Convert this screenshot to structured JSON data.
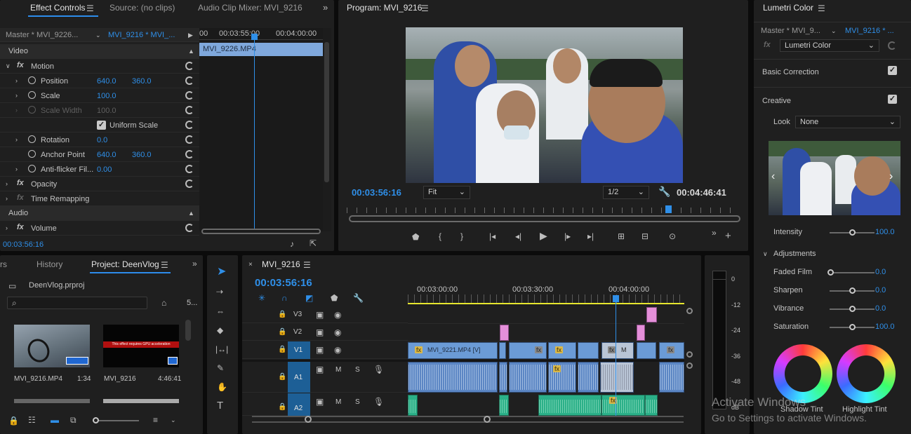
{
  "effect_controls": {
    "tabs": [
      "Effect Controls",
      "Source: (no clips)",
      "Audio Clip Mixer: MVI_9216"
    ],
    "master_label": "Master * MVI_9226...",
    "sequence_label": "MVI_9216 * MVI_...",
    "ruler_times": [
      "00:03:55:00",
      "00:04:00:00"
    ],
    "ruler_left": "00",
    "clip_name": "MVI_9226.MP4",
    "video_header": "Video",
    "motion": "Motion",
    "position_label": "Position",
    "position_x": "640.0",
    "position_y": "360.0",
    "scale_label": "Scale",
    "scale_value": "100.0",
    "scale_width_label": "Scale Width",
    "scale_width_value": "100.0",
    "uniform_scale": "Uniform Scale",
    "rotation_label": "Rotation",
    "rotation_value": "0.0",
    "anchor_label": "Anchor Point",
    "anchor_x": "640.0",
    "anchor_y": "360.0",
    "antiflicker_label": "Anti-flicker Fil...",
    "antiflicker_value": "0.00",
    "opacity": "Opacity",
    "time_remapping": "Time Remapping",
    "audio_header": "Audio",
    "volume": "Volume",
    "timecode": "00:03:56:16"
  },
  "program": {
    "title": "Program: MVI_9216",
    "timecode": "00:03:56:16",
    "fit": "Fit",
    "resolution": "1/2",
    "duration": "00:04:46:41"
  },
  "lumetri": {
    "title": "Lumetri Color",
    "master": "Master * MVI_9...",
    "sequence": "MVI_9216 * ...",
    "effect": "Lumetri Color",
    "basic_correction": "Basic Correction",
    "creative": "Creative",
    "look_label": "Look",
    "look_value": "None",
    "intensity_label": "Intensity",
    "intensity_value": "100.0",
    "intensity_level": 100,
    "adjustments": "Adjustments",
    "faded_film_label": "Faded Film",
    "faded_film_value": "0.0",
    "sharpen_label": "Sharpen",
    "sharpen_value": "0.0",
    "vibrance_label": "Vibrance",
    "vibrance_value": "0.0",
    "saturation_label": "Saturation",
    "saturation_value": "100.0",
    "shadow_tint": "Shadow Tint",
    "highlight_tint": "Highlight Tint"
  },
  "project": {
    "tabs": [
      "rs",
      "History",
      "Project: DeenVlog"
    ],
    "file": "DeenVlog.prproj",
    "count": "5...",
    "items": [
      {
        "name": "MVI_9216.MP4",
        "duration": "1:34"
      },
      {
        "name": "MVI_9216",
        "duration": "4:46:41"
      }
    ],
    "warning_text": "This effect requires GPU acceleration"
  },
  "timeline": {
    "title": "MVI_9216",
    "timecode": "00:03:56:16",
    "ruler_times": [
      "00:03:00:00",
      "00:03:30:00",
      "00:04:00:00"
    ],
    "tracks_video": [
      "V3",
      "V2",
      "V1"
    ],
    "tracks_audio": [
      "A1",
      "A2"
    ],
    "v1_clip": "MVI_9221.MP4 [V]",
    "mute": "M",
    "solo": "S"
  },
  "meter": {
    "scale": [
      "0",
      "-12",
      "-24",
      "-36",
      "-48",
      "dB"
    ]
  },
  "watermark": {
    "line1": "Activate Windows",
    "line2": "Go to Settings to activate Windows."
  }
}
